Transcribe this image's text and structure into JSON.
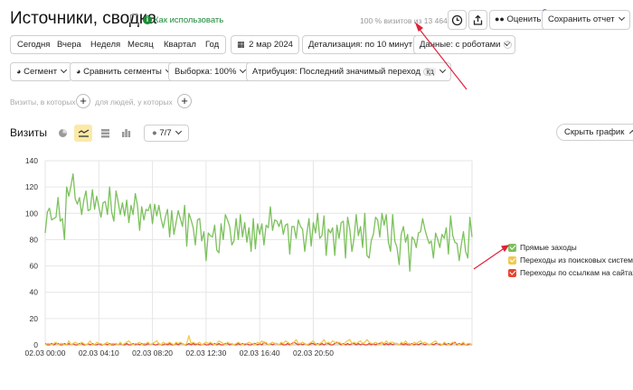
{
  "header": {
    "title": "Источники, сводка",
    "howto_label": "Как использовать",
    "visits_text": "100 % визитов из 13 464",
    "rate_label": "Оценить",
    "save_label": "Сохранить отчет"
  },
  "periods": [
    "Сегодня",
    "Вчера",
    "Неделя",
    "Месяц",
    "Квартал",
    "Год"
  ],
  "date_label": "2 мар 2024",
  "detail_label": "Детализация: по 10 минут",
  "data_label": "Данные: с роботами",
  "segment_label": "Сегмент",
  "compare_label": "Сравнить сегменты",
  "sample_label": "Выборка: 100%",
  "attribution_label": "Атрибуция: Последний значимый переход",
  "attribution_badge": "кд",
  "filters": {
    "visits_where": "Визиты, в которых",
    "people_where": "для людей, у которых"
  },
  "section_title": "Визиты",
  "metrics_label": "7/7",
  "hide_chart_label": "Скрыть график",
  "colors": {
    "green": "#7cc15c",
    "yellow": "#f2c94c",
    "red": "#e8442e",
    "arrow": "#e0203a",
    "accent_green": "#1a8a36"
  },
  "chart_data": {
    "type": "line",
    "ylim": [
      0,
      140
    ],
    "yticks": [
      0,
      20,
      40,
      60,
      80,
      100,
      120,
      140
    ],
    "xticks": [
      "02.03 00:00",
      "02.03 04:10",
      "02.03 08:20",
      "02.03 12:30",
      "02.03 16:40",
      "02.03 20:50"
    ],
    "series": [
      {
        "name": "Прямые заходы",
        "color": "#7cc15c",
        "values": [
          85,
          101,
          104,
          95,
          96,
          97,
          112,
          94,
          96,
          80,
          120,
          113,
          121,
          130,
          111,
          107,
          112,
          99,
          110,
          117,
          102,
          103,
          118,
          103,
          113,
          105,
          97,
          108,
          109,
          99,
          120,
          101,
          94,
          117,
          109,
          99,
          108,
          98,
          110,
          93,
          106,
          99,
          115,
          106,
          87,
          105,
          95,
          103,
          102,
          107,
          92,
          107,
          98,
          106,
          96,
          89,
          97,
          103,
          82,
          102,
          84,
          93,
          102,
          96,
          90,
          106,
          75,
          100,
          95,
          89,
          76,
          95,
          96,
          79,
          86,
          64,
          85,
          83,
          82,
          91,
          72,
          70,
          92,
          80,
          99,
          95,
          90,
          76,
          79,
          96,
          80,
          99,
          82,
          93,
          78,
          89,
          71,
          96,
          73,
          92,
          84,
          92,
          76,
          91,
          89,
          105,
          87,
          95,
          94,
          90,
          95,
          84,
          91,
          92,
          69,
          90,
          90,
          81,
          95,
          90,
          88,
          71,
          85,
          96,
          75,
          93,
          85,
          100,
          81,
          83,
          98,
          68,
          88,
          85,
          89,
          68,
          91,
          81,
          93,
          94,
          66,
          97,
          88,
          71,
          81,
          99,
          83,
          90,
          74,
          100,
          68,
          66,
          79,
          84,
          97,
          95,
          82,
          100,
          91,
          99,
          78,
          71,
          99,
          79,
          74,
          61,
          84,
          90,
          78,
          84,
          56,
          82,
          80,
          74,
          85,
          86,
          96,
          88,
          82,
          77,
          79,
          66,
          85,
          80,
          74,
          84,
          81,
          89,
          69,
          98,
          83,
          78,
          77,
          64,
          76,
          86,
          71,
          66,
          97,
          82
        ]
      },
      {
        "name": "Переходы из поисковых систем",
        "color": "#f2c94c",
        "values": [
          0,
          1,
          1,
          0,
          1,
          2,
          0,
          1,
          1,
          0,
          0,
          3,
          0,
          1,
          2,
          1,
          0,
          2,
          1,
          0,
          1,
          3,
          0,
          0,
          2,
          1,
          1,
          0,
          1,
          2,
          0,
          1,
          1,
          1,
          0,
          2,
          0,
          1,
          2,
          3,
          1,
          0,
          1,
          1,
          2,
          0,
          1,
          1,
          2,
          0,
          1,
          2,
          3,
          1,
          0,
          2,
          1,
          1,
          2,
          1,
          0,
          2,
          1,
          2,
          1,
          0,
          1,
          7,
          1,
          2,
          1,
          1,
          2,
          0,
          1,
          2,
          1,
          2,
          1,
          0,
          1,
          3,
          2,
          1,
          0,
          2,
          1,
          1,
          0,
          1,
          2,
          1,
          0,
          1,
          1,
          2,
          1,
          1,
          0,
          2,
          1,
          3,
          1,
          2,
          0,
          1,
          2,
          1,
          1,
          0,
          2,
          1,
          3,
          2,
          1,
          0,
          2,
          4,
          1,
          1,
          2,
          1,
          0,
          1,
          2,
          3,
          1,
          0,
          1,
          2,
          4,
          1,
          2,
          1,
          3,
          2,
          1,
          2,
          1,
          0,
          2,
          3,
          4,
          1,
          2,
          1,
          2,
          3,
          1,
          2,
          4,
          2,
          1,
          1,
          2,
          1,
          0,
          2,
          1,
          3,
          1,
          2,
          2,
          1,
          1,
          0,
          2,
          1,
          3,
          1,
          1,
          0,
          2,
          1,
          2,
          3,
          1,
          2,
          1,
          0,
          1,
          2,
          3,
          1,
          1,
          0,
          2,
          1,
          0,
          1,
          2,
          1,
          1,
          0,
          1,
          2,
          0,
          1,
          1,
          0
        ]
      },
      {
        "name": "Переходы по ссылкам на сайтах",
        "color": "#e8442e",
        "values": [
          1,
          0,
          0,
          1,
          0,
          1,
          1,
          0,
          0,
          1,
          0,
          1,
          0,
          1,
          0,
          0,
          1,
          1,
          0,
          0,
          1,
          0,
          1,
          0,
          0,
          1,
          0,
          0,
          1,
          0,
          1,
          0,
          0,
          1,
          0,
          1,
          0,
          0,
          1,
          0,
          0,
          1,
          0,
          1,
          0,
          1,
          0,
          0,
          1,
          0,
          1,
          0,
          0,
          1,
          0,
          0,
          1,
          0,
          1,
          0,
          0,
          1,
          0,
          1,
          1,
          0,
          0,
          1,
          0,
          1,
          0,
          1,
          0,
          0,
          1,
          0,
          0,
          1,
          0,
          1,
          0,
          1,
          0,
          0,
          1,
          1,
          0,
          1,
          0,
          0,
          1,
          0,
          1,
          0,
          1,
          0,
          0,
          1,
          1,
          0,
          1,
          0,
          2,
          1,
          0,
          1,
          0,
          1,
          1,
          0,
          1,
          0,
          0,
          1,
          0,
          1,
          2,
          1,
          0,
          1,
          0,
          1,
          0,
          0,
          1,
          1,
          0,
          1,
          0,
          1,
          0,
          1,
          1,
          0,
          0,
          1,
          2,
          1,
          0,
          1,
          0,
          1,
          0,
          1,
          1,
          0,
          1,
          0,
          1,
          0,
          0,
          1,
          0,
          1,
          0,
          1,
          1,
          2,
          0,
          1,
          0,
          1,
          0,
          1,
          1,
          0,
          1,
          0,
          1,
          0,
          0,
          1,
          0,
          1,
          0,
          1,
          1,
          0,
          1,
          0,
          1,
          0,
          1,
          1,
          0,
          0,
          1,
          0,
          1,
          0,
          1,
          2,
          0,
          1,
          0,
          1,
          0,
          0,
          1,
          0
        ]
      }
    ]
  }
}
